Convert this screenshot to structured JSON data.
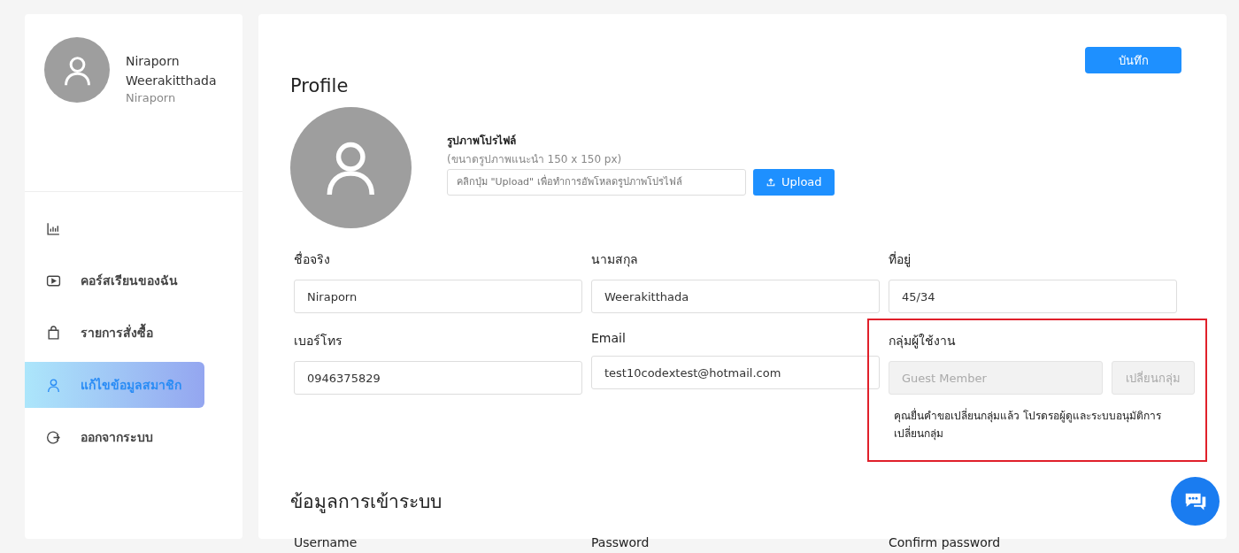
{
  "sidebar": {
    "user": {
      "name": "Niraporn Weerakitthada",
      "username": "Niraporn"
    },
    "items": [
      {
        "kind": "chart",
        "selected": false
      },
      {
        "kind": "video",
        "label": "คอร์สเรียนของฉัน",
        "selected": false
      },
      {
        "kind": "bag",
        "label": "รายการสั่งซื้อ",
        "selected": false
      },
      {
        "kind": "user",
        "label": "แก้ไขข้อมูลสมาชิก",
        "selected": true
      },
      {
        "kind": "logout",
        "label": "ออกจากระบบ",
        "selected": false
      }
    ]
  },
  "save_button": "บันทึก",
  "profile": {
    "title": "Profile",
    "photo_label": "รูปภาพโปรไฟล์",
    "photo_hint": "(ขนาดรูปภาพแนะนำ 150 x 150 px)",
    "photo_field": {
      "placeholder": "คลิกปุ่ม \"Upload\" เพื่อทำการอัพโหลดรูปภาพโปรไฟล์"
    },
    "upload_button": "Upload",
    "fields": [
      {
        "label": "ชื่อจริง",
        "value": "Niraporn"
      },
      {
        "label": "นามสกุล",
        "value": "Weerakitthada"
      },
      {
        "label": "ที่อยู่",
        "value": "45/34"
      },
      {
        "label": "เบอร์โทร",
        "value": "0946375829"
      },
      {
        "label": "Email",
        "value": "test10codextest@hotmail.com"
      }
    ],
    "user_group": {
      "label": "กลุ่มผู้ใช้งาน",
      "value": "Guest Member",
      "disabled": true,
      "button": "เปลี่ยนกลุ่ม",
      "note": "คุณยื่นคำขอเปลี่ยนกลุ่มแล้ว โปรดรอผู้ดูและระบบอนุมัติการเปลี่ยนกลุ่ม",
      "highlighted": true
    }
  },
  "login": {
    "title": "ข้อมูลการเข้าระบบ",
    "fields": [
      {
        "label": "Username"
      },
      {
        "label": "Password"
      },
      {
        "label": "Confirm password"
      }
    ]
  }
}
